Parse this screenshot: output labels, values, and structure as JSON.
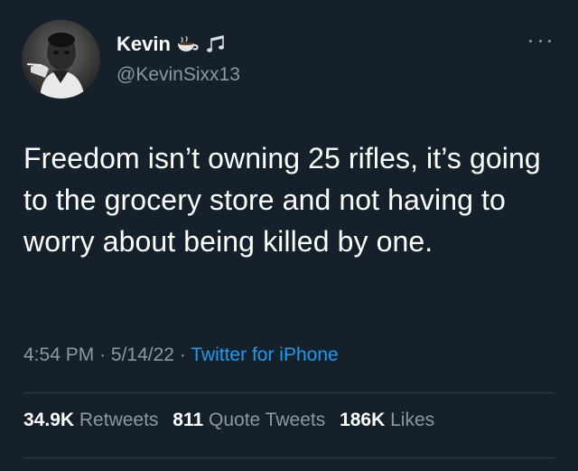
{
  "author": {
    "display_name": "Kevin",
    "handle": "@KevinSixx13",
    "name_emojis": [
      "hot-beverage-emoji",
      "musical-notes-emoji"
    ]
  },
  "tweet": {
    "text": "Freedom isn’t owning 25 rifles, it’s going to the grocery store and not having to worry about being killed by one.",
    "time": "4:54 PM",
    "date": "5/14/22",
    "source": "Twitter for iPhone",
    "separator": "·"
  },
  "stats": {
    "retweets_count": "34.9K",
    "retweets_label": "Retweets",
    "quotes_count": "811",
    "quotes_label": "Quote Tweets",
    "likes_count": "186K",
    "likes_label": "Likes"
  },
  "colors": {
    "background": "#15202b",
    "primary_text": "#ffffff",
    "secondary_text": "#8b98a5",
    "link": "#1d9bf0",
    "divider": "#2f3b47"
  }
}
